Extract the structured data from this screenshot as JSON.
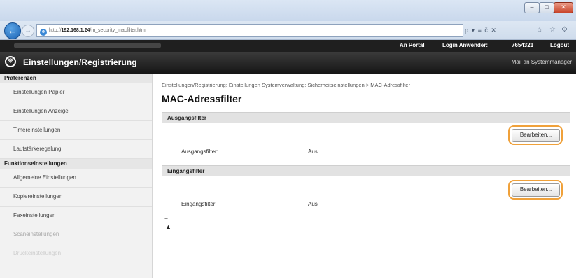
{
  "browser": {
    "url_prefix": "http://",
    "url_host": "192.168.1.24",
    "url_path": "/m_security_macfilter.html",
    "tools": "ρ ▾ ≡ č ✕",
    "min": "–",
    "max": "□",
    "close": "✕",
    "home_icon": "⌂",
    "star_icon": "☆",
    "gear_icon": "⚙"
  },
  "header": {
    "portal_link": "An Portal",
    "login_label": "Login Anwender:",
    "login_user": "7654321",
    "logout_link": "Logout",
    "page_title": "Einstellungen/Registrierung",
    "mail_link": "Mail an Systemmanager"
  },
  "sidebar": {
    "sections": [
      {
        "title": "Präferenzen",
        "items": [
          "Einstellungen Papier",
          "Einstellungen Anzeige",
          "Timereinstellungen",
          "Lautstärkeregelung"
        ]
      },
      {
        "title": "Funktionseinstellungen",
        "items": [
          "Allgemeine Einstellungen",
          "Kopiereinstellungen",
          "Faxeinstellungen",
          "Scaneinstellungen",
          "Druckeinstellungen"
        ]
      }
    ]
  },
  "main": {
    "breadcrumb": "Einstellungen/Registrierung: Einstellungen Systemverwaltung: Sicherheitseinstellungen > MAC-Adressfilter",
    "title": "MAC-Adressfilter",
    "outbound": {
      "header": "Ausgangsfilter",
      "button": "Bearbeiten...",
      "label": "Ausgangsfilter:",
      "value": "Aus"
    },
    "inbound": {
      "header": "Eingangsfilter",
      "button": "Bearbeiten...",
      "label": "Eingangsfilter:",
      "value": "Aus"
    },
    "to_top_icon": "▲"
  },
  "colors": {
    "highlight": "#f0a13a",
    "header_bg": "#1f1f1f",
    "section_bar": "#e2e2e2"
  }
}
